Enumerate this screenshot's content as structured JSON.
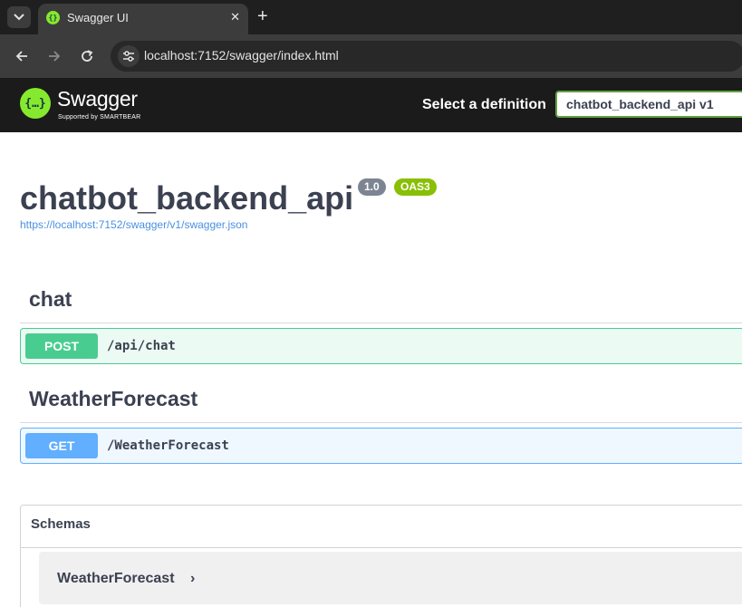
{
  "browser": {
    "tab_title": "Swagger UI",
    "tab_close": "✕",
    "new_tab": "+",
    "url": "localhost:7152/swagger/index.html",
    "icons": [
      "tab-list-icon",
      "favicon-icon",
      "close-icon",
      "plus-icon",
      "back-icon",
      "forward-icon",
      "reload-icon",
      "site-info-icon"
    ]
  },
  "topbar": {
    "logo_text": "Swagger",
    "logo_sub": "Supported by SMARTBEAR",
    "logo_glyph": "{…}",
    "definition_label": "Select a definition",
    "definition_value": "chatbot_backend_api v1"
  },
  "info": {
    "title": "chatbot_backend_api",
    "version": "1.0",
    "oas": "OAS3",
    "spec_url": "https://localhost:7152/swagger/v1/swagger.json"
  },
  "tags": [
    {
      "name": "chat",
      "operations": [
        {
          "method": "POST",
          "path": "/api/chat"
        }
      ]
    },
    {
      "name": "WeatherForecast",
      "operations": [
        {
          "method": "GET",
          "path": "/WeatherForecast"
        }
      ]
    }
  ],
  "schemas": {
    "title": "Schemas",
    "models": [
      {
        "name": "WeatherForecast",
        "chevron": "›"
      }
    ]
  },
  "colors": {
    "swagger_green": "#85ea2d",
    "post": "#49cc90",
    "get": "#61affe",
    "text": "#3b4151",
    "link": "#4990e2"
  }
}
